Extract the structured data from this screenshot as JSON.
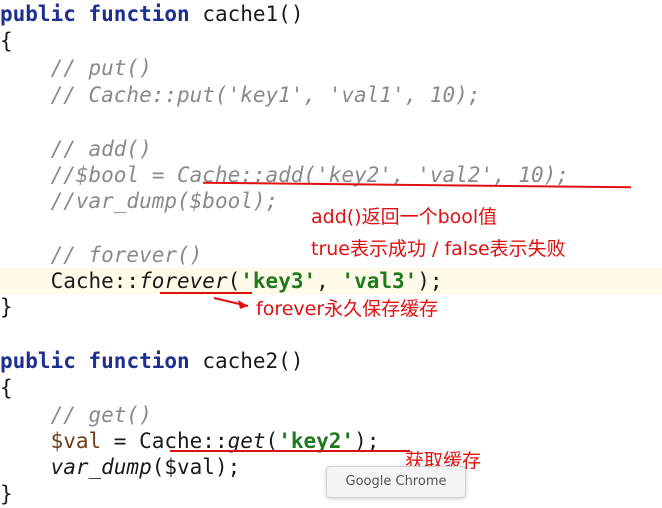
{
  "code": {
    "f1_keyword_public": "public",
    "f1_keyword_function": "function",
    "f1_name": "cache1()",
    "brace_open": "{",
    "brace_close": "}",
    "c_put": "// put()",
    "c_put_example": "// Cache::put('key1', 'val1', 10);",
    "c_add": "// add()",
    "c_add_prefix": "//$bool = ",
    "c_add_call": "Cache::add('key2', 'val2', 10);",
    "c_var_dump": "//var_dump($bool);",
    "c_forever": "// forever()",
    "forever_prefix": "Cache::",
    "forever_method": "forever",
    "forever_open": "(",
    "forever_arg1": "'key3'",
    "forever_comma": ", ",
    "forever_arg2": "'val3'",
    "forever_close": ");",
    "f2_keyword_public": "public",
    "f2_keyword_function": "function",
    "f2_name": "cache2()",
    "c_get": "// get()",
    "get_var": "$val",
    "get_assign": " = ",
    "get_class": "Cache::",
    "get_method": "get",
    "get_open": "(",
    "get_arg": "'key2'",
    "get_close": ");",
    "var_dump_fn": "var_dump",
    "var_dump_args": "($val);"
  },
  "annotations": {
    "add_line1": "add()返回一个bool值",
    "add_line2": "true表示成功   /   false表示失败",
    "forever": "forever永久保存缓存",
    "get": "获取缓存"
  },
  "tooltip": {
    "label": "Google Chrome"
  },
  "colors": {
    "keyword": "#1f2f8f",
    "comment": "#8a8a8a",
    "string": "#1f7a1f",
    "annotation": "#e01010"
  }
}
